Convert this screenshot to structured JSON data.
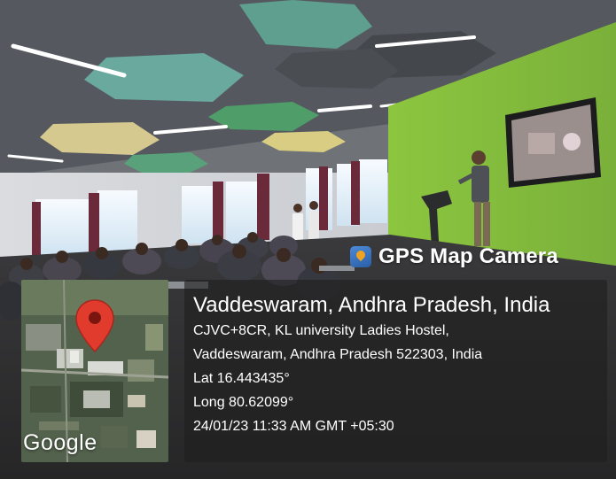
{
  "overlay": {
    "app_name": "GPS Map Camera",
    "headline": "Vaddeswaram, Andhra Pradesh, India",
    "address_line1": "CJVC+8CR, KL university Ladies Hostel,",
    "address_line2": "Vaddeswaram, Andhra Pradesh 522303, India",
    "latitude": "Lat 16.443435°",
    "longitude": "Long 80.62099°",
    "timestamp": "24/01/23 11:33 AM GMT +05:30"
  },
  "map": {
    "logo_text": "Google",
    "pin_color": "#e03b2c",
    "map_base_color": "#53624d"
  },
  "scene": {
    "wall_accent_color": "#8fc23b",
    "ceiling_panel_color": "#5e9f8f"
  }
}
